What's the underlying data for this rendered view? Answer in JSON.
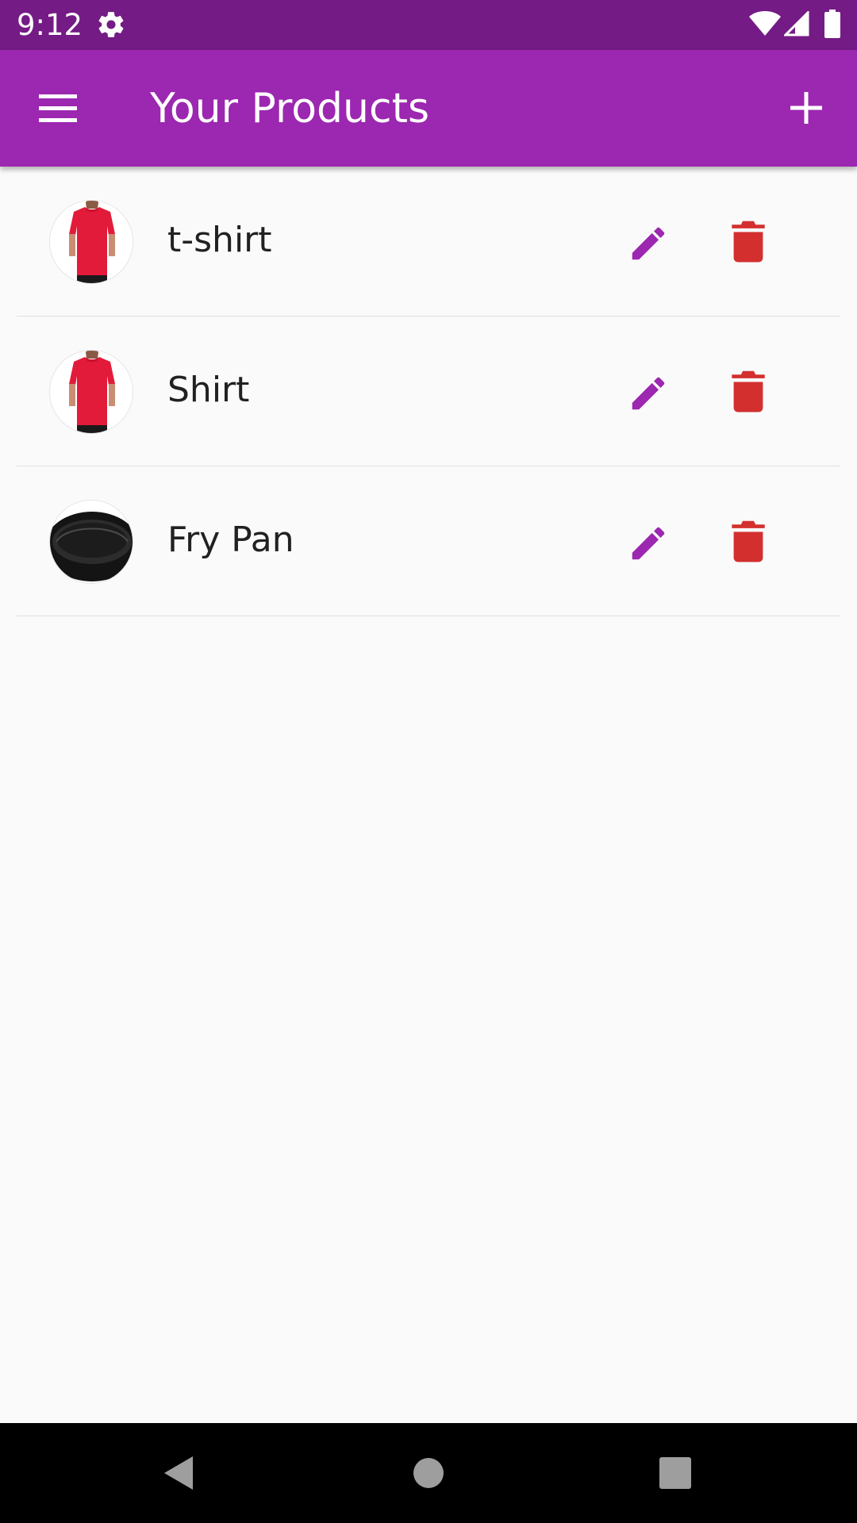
{
  "status_bar": {
    "time": "9:12",
    "icons": [
      "settings-icon",
      "wifi-icon",
      "signal-icon",
      "battery-icon"
    ],
    "background": "#741b85"
  },
  "app_bar": {
    "title": "Your Products",
    "menu_icon": "menu-icon",
    "add_icon": "add-icon",
    "background": "#9c27b0"
  },
  "products": [
    {
      "name": "t-shirt",
      "thumbnail": "red-tshirt"
    },
    {
      "name": "Shirt",
      "thumbnail": "red-tshirt"
    },
    {
      "name": "Fry Pan",
      "thumbnail": "black-fry-pan"
    }
  ],
  "actions": {
    "edit_icon": "pencil-icon",
    "delete_icon": "trash-icon",
    "edit_color": "#9c27b0",
    "delete_color": "#d32f2f"
  },
  "nav_bar": {
    "icons": [
      "back-icon",
      "home-icon",
      "recents-icon"
    ],
    "background": "#000000"
  }
}
